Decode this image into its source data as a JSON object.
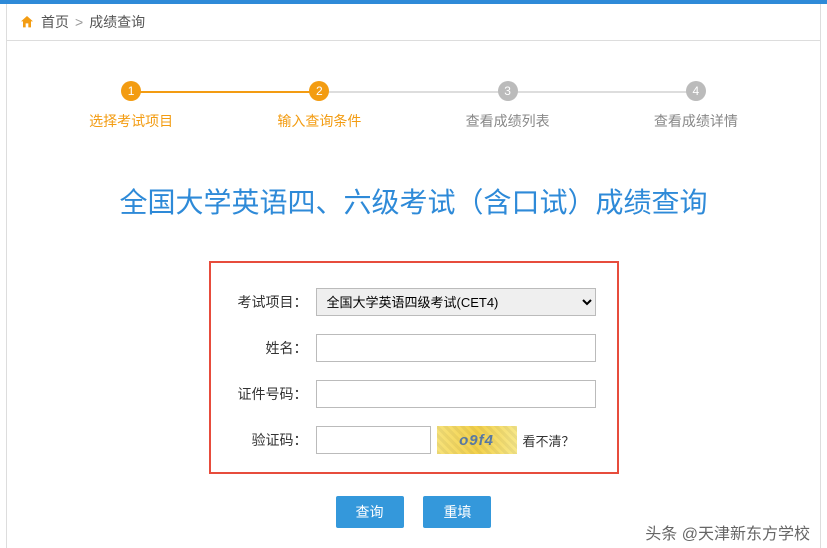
{
  "breadcrumb": {
    "home": "首页",
    "current": "成绩查询"
  },
  "steps": [
    {
      "num": "1",
      "label": "选择考试项目"
    },
    {
      "num": "2",
      "label": "输入查询条件"
    },
    {
      "num": "3",
      "label": "查看成绩列表"
    },
    {
      "num": "4",
      "label": "查看成绩详情"
    }
  ],
  "title": "全国大学英语四、六级考试（含口试）成绩查询",
  "form": {
    "exam_label": "考试项目：",
    "exam_selected": "全国大学英语四级考试(CET4)",
    "name_label": "姓名：",
    "name_value": "",
    "id_label": "证件号码：",
    "id_value": "",
    "captcha_label": "验证码：",
    "captcha_value": "",
    "captcha_text": "o9f4",
    "captcha_refresh": "看不清？"
  },
  "buttons": {
    "query": "查询",
    "reset": "重填"
  },
  "watermark": "头条 @天津新东方学校"
}
